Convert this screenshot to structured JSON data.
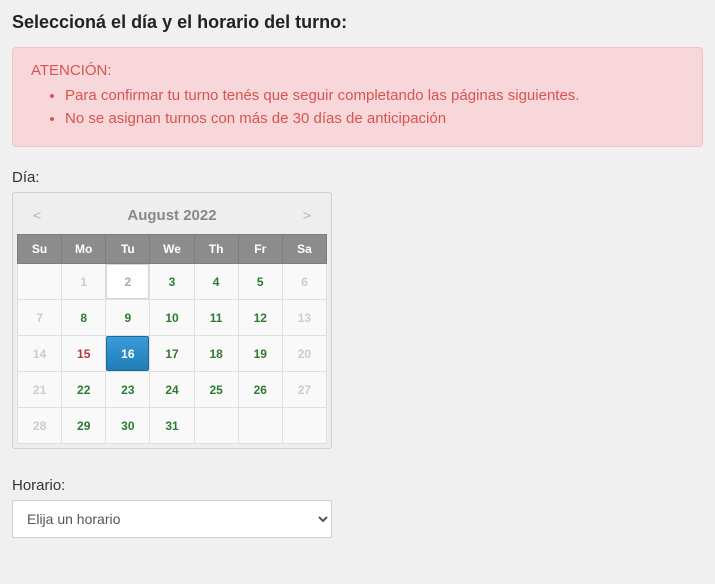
{
  "page": {
    "title": "Seleccioná el día y el horario del turno:"
  },
  "alert": {
    "heading": "ATENCIÓN:",
    "items": [
      "Para confirmar tu turno tenés que seguir completando las páginas siguientes.",
      "No se asignan turnos con más de 30 días de anticipación"
    ]
  },
  "day": {
    "label": "Día:"
  },
  "calendar": {
    "prev": "<",
    "next": ">",
    "month_year": "August 2022",
    "weekdays": [
      "Su",
      "Mo",
      "Tu",
      "We",
      "Th",
      "Fr",
      "Sa"
    ],
    "cells": [
      [
        "",
        "1",
        "2",
        "3",
        "4",
        "5",
        "6"
      ],
      [
        "7",
        "8",
        "9",
        "10",
        "11",
        "12",
        "13"
      ],
      [
        "14",
        "15",
        "16",
        "17",
        "18",
        "19",
        "20"
      ],
      [
        "21",
        "22",
        "23",
        "24",
        "25",
        "26",
        "27"
      ],
      [
        "28",
        "29",
        "30",
        "31",
        "",
        "",
        ""
      ]
    ],
    "cell_state": [
      [
        "empty",
        "out",
        "today",
        "avail",
        "avail",
        "avail",
        "out"
      ],
      [
        "out",
        "avail",
        "avail",
        "avail",
        "avail",
        "avail",
        "out"
      ],
      [
        "out",
        "past-red",
        "selected",
        "avail",
        "avail",
        "avail",
        "out"
      ],
      [
        "out",
        "avail",
        "avail",
        "avail",
        "avail",
        "avail",
        "out"
      ],
      [
        "out",
        "avail",
        "avail",
        "avail",
        "empty",
        "empty",
        "empty"
      ]
    ]
  },
  "time": {
    "label": "Horario:",
    "placeholder": "Elija un horario"
  }
}
